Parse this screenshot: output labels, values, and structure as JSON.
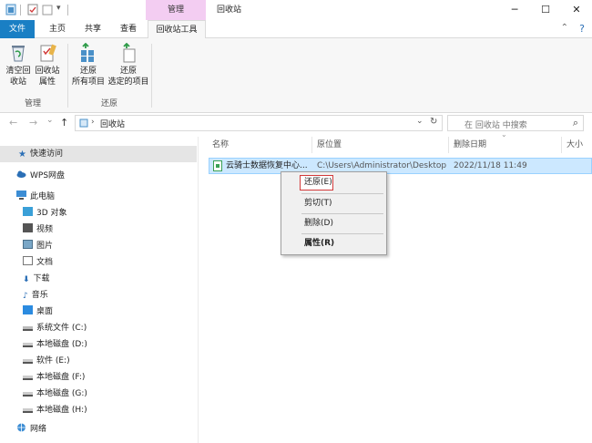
{
  "titlebar": {
    "context_group": "管理",
    "window_title": "回收站",
    "minimize": "─",
    "maximize": "☐",
    "close": "✕"
  },
  "tabs": [
    "文件",
    "主页",
    "共享",
    "查看",
    "回收站工具"
  ],
  "ribbon": {
    "collapse_glyph": "⌃",
    "help_glyph": "?",
    "buttons": [
      {
        "line1": "清空回",
        "line2": "收站",
        "icon": "empty-recycle-bin-icon"
      },
      {
        "line1": "回收站",
        "line2": "属性",
        "icon": "recycle-bin-properties-icon"
      },
      {
        "line1": "还原",
        "line2": "所有项目",
        "icon": "restore-all-icon"
      },
      {
        "line1": "还原",
        "line2": "选定的项目",
        "icon": "restore-selected-icon"
      }
    ],
    "groups": [
      "管理",
      "还原"
    ]
  },
  "address": {
    "back": "←",
    "forward": "→",
    "recent": "⌄",
    "up": "↑",
    "separator": "›",
    "path": "回收站",
    "dropdown": "⌄",
    "refresh": "↻",
    "search_placeholder": "在 回收站 中搜索",
    "search_glyph": "⌕"
  },
  "nav": {
    "quick_access": "快速访问",
    "wps": "WPS网盘",
    "this_pc": "此电脑",
    "items": [
      "3D 对象",
      "视频",
      "图片",
      "文档",
      "下载",
      "音乐",
      "桌面",
      "系统文件 (C:)",
      "本地磁盘 (D:)",
      "软件 (E:)",
      "本地磁盘 (F:)",
      "本地磁盘 (G:)",
      "本地磁盘 (H:)"
    ],
    "network": "网络"
  },
  "columns": {
    "name": "名称",
    "location": "原位置",
    "deleted": "删除日期",
    "size": "大小",
    "sort_glyph": "⌄"
  },
  "file": {
    "name": "云骑士数据恢复中心...",
    "location": "C:\\Users\\Administrator\\Desktop",
    "deleted": "2022/11/18 11:49"
  },
  "context_menu": [
    "还原(E)",
    "剪切(T)",
    "删除(D)",
    "属性(R)"
  ],
  "colors": {
    "file_tab": "#1a7fc4",
    "context_tab": "#f3cdf2",
    "selection": "#cce8ff",
    "highlight_border": "#d23a3a"
  }
}
